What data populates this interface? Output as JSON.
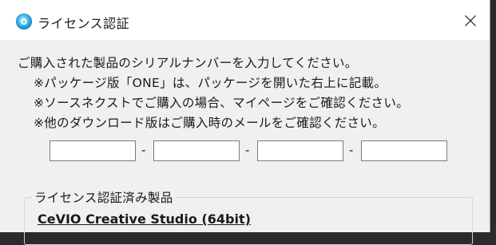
{
  "window": {
    "title": "ライセンス認証",
    "icon": "cevio-app-icon",
    "close_icon": "close-icon"
  },
  "instructions": {
    "line1": "ご購入された製品のシリアルナンバーを入力してください。",
    "line2": "※パッケージ版「ONE」は、パッケージを開いた右上に記載。",
    "line3": "※ソースネクストでご購入の場合、マイページをご確認ください。",
    "line4": "※他のダウンロード版はご購入時のメールをご確認ください。"
  },
  "serial": {
    "separator": "-",
    "fields": [
      {
        "value": "",
        "placeholder": ""
      },
      {
        "value": "",
        "placeholder": ""
      },
      {
        "value": "",
        "placeholder": ""
      },
      {
        "value": "",
        "placeholder": ""
      }
    ]
  },
  "licensed": {
    "group_label": "ライセンス認証済み製品",
    "products": [
      "CeVIO Creative Studio (64bit)"
    ]
  },
  "colors": {
    "background": "#f0f0f0",
    "titlebar": "#ffffff",
    "text": "#1a1a1a",
    "input_border": "#7a7a7a"
  }
}
